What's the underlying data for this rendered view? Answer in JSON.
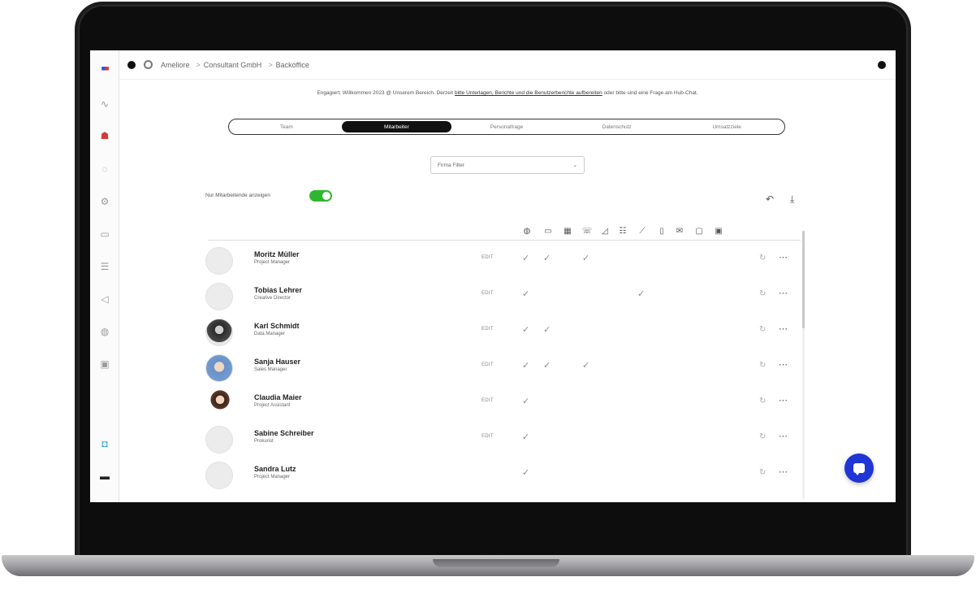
{
  "breadcrumb": [
    "Ameliore",
    "Consultant GmbH",
    "Backoffice"
  ],
  "info": {
    "text": "Engagiert: Willkommen 2023 @ Unserem Bereich. Derzeit",
    "link": "bitte Unterlagen, Berichte und die Benutzerberichte aufbereiten",
    "suffix": "oder bitte sind eine Frage am Hub-Chat."
  },
  "tabs": [
    "Team",
    "Mitarbeiter",
    "Personalfrage",
    "Datenschutz",
    "Umsatzziele"
  ],
  "active_tab": "Mitarbeiter",
  "dropdown": {
    "value": "Firma Filter"
  },
  "toggle": {
    "label": "Nur Mitarbeitende anzeigen",
    "on": true
  },
  "column_icons": [
    "globe-icon",
    "screen-icon",
    "calendar-icon",
    "phone-icon",
    "chart-icon",
    "list-icon",
    "link-icon",
    "document-icon",
    "mail-icon",
    "box-icon",
    "gift-icon"
  ],
  "edit_label": "EDIT",
  "rows": [
    {
      "name": "Moritz Müller",
      "role": "Project Manager",
      "checks": [
        0,
        1,
        3
      ]
    },
    {
      "name": "Tobias Lehrer",
      "role": "Creative Director",
      "checks": [
        0,
        6
      ]
    },
    {
      "name": "Karl Schmidt",
      "role": "Data Manager",
      "checks": [
        0,
        1
      ]
    },
    {
      "name": "Sanja Hauser",
      "role": "Sales Manager",
      "checks": [
        0,
        1,
        3
      ]
    },
    {
      "name": "Claudia Maier",
      "role": "Project Assistant",
      "checks": [
        0
      ]
    },
    {
      "name": "Sabine Schreiber",
      "role": "Prokurist",
      "checks": [
        0
      ]
    },
    {
      "name": "Sandra Lutz",
      "role": "Project Manager",
      "checks": [
        0
      ]
    }
  ],
  "colors": {
    "accent": "#1f35d6",
    "toggle": "#2fb62f",
    "tab_active": "#111111"
  }
}
